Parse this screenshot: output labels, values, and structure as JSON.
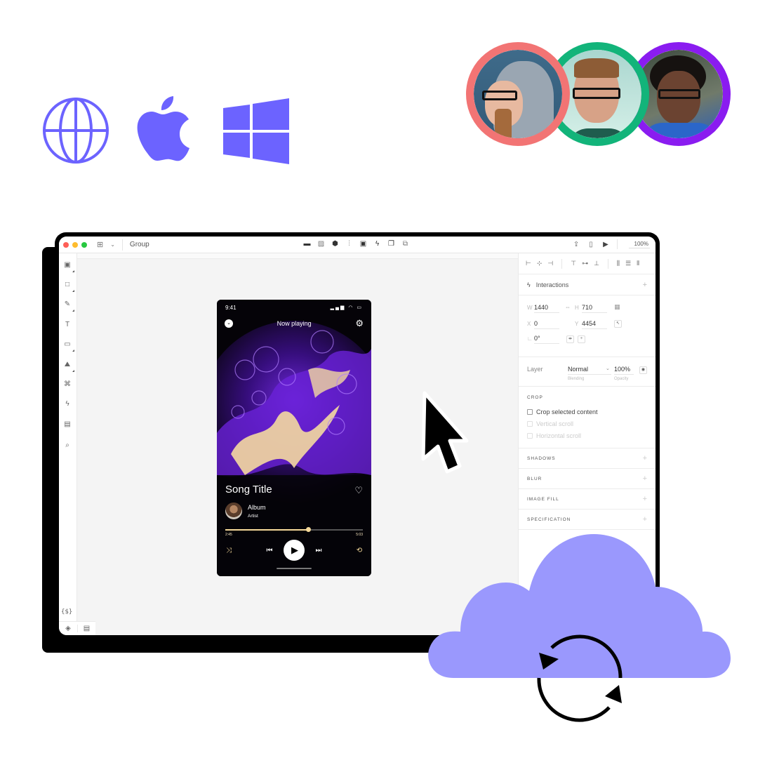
{
  "platform_icons": [
    {
      "name": "globe-icon",
      "label": "Web"
    },
    {
      "name": "apple-icon",
      "label": "macOS"
    },
    {
      "name": "windows-icon",
      "label": "Windows"
    }
  ],
  "brand_color": "#6c63ff",
  "avatars": [
    {
      "ring_color": "#f27474",
      "label": "Collaborator 1"
    },
    {
      "ring_color": "#12b47a",
      "label": "Collaborator 2"
    },
    {
      "ring_color": "#8a1cf0",
      "label": "Collaborator 3"
    }
  ],
  "app": {
    "toolbar": {
      "layout_toggle": "grid-icon",
      "title": "Group",
      "center_tools": [
        "folder-icon",
        "pattern-icon",
        "component-icon",
        "split-icon",
        "image-icon",
        "bolt-icon",
        "layers-stack-icon",
        "copy-icon"
      ],
      "right_tools": [
        "export-icon",
        "device-preview-icon",
        "play-icon"
      ],
      "zoom": "100%"
    },
    "left_tools": [
      {
        "name": "frame-tool",
        "glyph": "▣"
      },
      {
        "name": "rectangle-tool",
        "glyph": "□"
      },
      {
        "name": "pen-tool",
        "glyph": "✎"
      },
      {
        "name": "text-tool",
        "glyph": "T"
      },
      {
        "name": "button-tool",
        "glyph": "▭"
      },
      {
        "name": "image-tool",
        "glyph": "⛰"
      },
      {
        "name": "symbols-tool",
        "glyph": "⌘"
      },
      {
        "name": "interaction-tool",
        "glyph": "ϟ"
      },
      {
        "name": "comment-tool",
        "glyph": "▤"
      },
      {
        "name": "search-tool",
        "glyph": "⌕"
      }
    ],
    "variables_label": "{$}",
    "bottom_tools": [
      "layers-icon",
      "assets-icon"
    ],
    "panel": {
      "interactions_label": "Interactions",
      "w_label": "W",
      "w_value": "1440",
      "h_label": "H",
      "h_value": "710",
      "x_label": "X",
      "x_value": "0",
      "y_label": "Y",
      "y_value": "4454",
      "rotation_value": "0°",
      "layer_label": "Layer",
      "blending_value": "Normal",
      "blending_caption": "Blending",
      "opacity_value": "100%",
      "opacity_caption": "Opacity",
      "crop_heading": "CROP",
      "crop_options": [
        {
          "label": "Crop selected content",
          "checked": false,
          "disabled": false
        },
        {
          "label": "Vertical scroll",
          "checked": false,
          "disabled": true
        },
        {
          "label": "Horizontal scroll",
          "checked": false,
          "disabled": true
        }
      ],
      "sections": [
        "SHADOWS",
        "BLUR",
        "IMAGE FILL",
        "SPECIFICATION"
      ]
    },
    "phone": {
      "time": "9:41",
      "status_icons": "signal wifi battery",
      "header_title": "Now playing",
      "song_title": "Song Title",
      "album": "Album",
      "artist": "Artist",
      "elapsed": "2:45",
      "duration": "5:03",
      "progress": 0.6,
      "accent": "#f5d99a"
    }
  }
}
